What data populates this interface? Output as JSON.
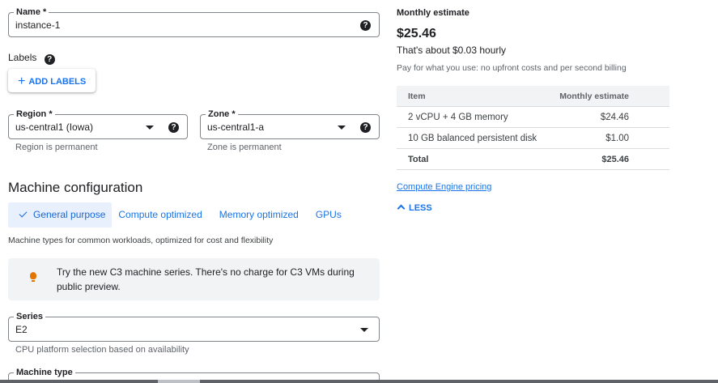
{
  "form": {
    "name": {
      "label": "Name *",
      "value": "instance-1",
      "help": "?"
    },
    "labels": {
      "title": "Labels",
      "help": "?",
      "add_button": "ADD LABELS"
    },
    "region": {
      "label": "Region *",
      "value": "us-central1 (Iowa)",
      "hint": "Region is permanent",
      "help": "?"
    },
    "zone": {
      "label": "Zone *",
      "value": "us-central1-a",
      "hint": "Zone is permanent",
      "help": "?"
    }
  },
  "machine_config": {
    "title": "Machine configuration",
    "tabs": [
      {
        "label": "General purpose",
        "selected": true
      },
      {
        "label": "Compute optimized",
        "selected": false
      },
      {
        "label": "Memory optimized",
        "selected": false
      },
      {
        "label": "GPUs",
        "selected": false
      }
    ],
    "description": "Machine types for common workloads, optimized for cost and flexibility",
    "banner": "Try the new C3 machine series. There's no charge for C3 VMs during public preview.",
    "series": {
      "label": "Series",
      "value": "E2",
      "hint": "CPU platform selection based on availability"
    },
    "machine_type": {
      "label": "Machine type"
    }
  },
  "estimate": {
    "title": "Monthly estimate",
    "price": "$25.46",
    "hourly": "That's about $0.03 hourly",
    "note": "Pay for what you use: no upfront costs and per second billing",
    "table": {
      "headers": [
        "Item",
        "Monthly estimate"
      ],
      "rows": [
        [
          "2 vCPU + 4 GB memory",
          "$24.46"
        ],
        [
          "10 GB balanced persistent disk",
          "$1.00"
        ]
      ],
      "total": [
        "Total",
        "$25.46"
      ]
    },
    "pricing_link": "Compute Engine pricing",
    "less_button": "LESS"
  },
  "colors": {
    "accent": "#1a73e8",
    "tab_selected_bg": "#e8f0fe",
    "banner_bg": "#f1f3f4",
    "bulb": "#e37400"
  }
}
